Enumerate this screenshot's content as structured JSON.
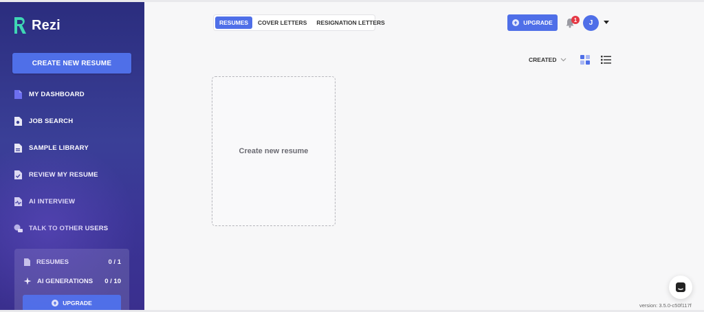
{
  "brand": {
    "name": "Rezi"
  },
  "sidebar": {
    "create_label": "CREATE NEW RESUME",
    "items": [
      {
        "label": "MY DASHBOARD",
        "icon": "document-icon"
      },
      {
        "label": "JOB SEARCH",
        "icon": "job-search-icon"
      },
      {
        "label": "SAMPLE LIBRARY",
        "icon": "library-icon"
      },
      {
        "label": "REVIEW MY RESUME",
        "icon": "review-icon"
      },
      {
        "label": "AI INTERVIEW",
        "icon": "ai-interview-icon"
      },
      {
        "label": "TALK TO OTHER USERS",
        "icon": "chat-bubble-icon"
      }
    ],
    "usage": {
      "resumes_label": "RESUMES",
      "resumes_count": "0 / 1",
      "ai_label": "AI GENERATIONS",
      "ai_count": "0 / 10",
      "upgrade_label": "UPGRADE"
    }
  },
  "tabs": [
    {
      "label": "RESUMES",
      "active": true
    },
    {
      "label": "COVER LETTERS",
      "active": false
    },
    {
      "label": "RESIGNATION LETTERS",
      "active": false
    }
  ],
  "header": {
    "upgrade_label": "UPGRADE",
    "notification_count": "1",
    "avatar_initial": "J"
  },
  "toolbar": {
    "sort_label": "CREATED"
  },
  "main": {
    "new_card_label": "Create new resume"
  },
  "footer": {
    "version": "version: 3.5.0-c50f117f"
  },
  "colors": {
    "accent": "#4f6fe8",
    "sidebar": "#2f3388",
    "badge": "#e53945"
  }
}
